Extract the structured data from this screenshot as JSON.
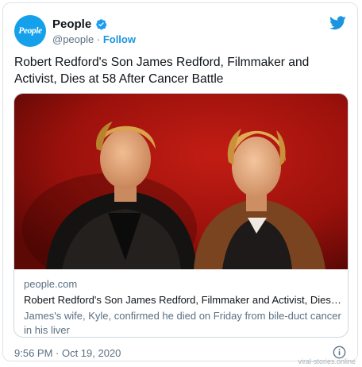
{
  "author": {
    "avatar_text": "People",
    "display_name": "People",
    "handle": "@people",
    "separator": " · ",
    "follow_label": "Follow"
  },
  "tweet": {
    "text": "Robert Redford's Son James Redford, Filmmaker and Activist, Dies at 58 After Cancer Battle"
  },
  "card": {
    "domain": "people.com",
    "title": "Robert Redford's Son James Redford, Filmmaker and Activist, Dies at …",
    "description": "James's wife, Kyle, confirmed he died on Friday from bile-duct cancer in his liver"
  },
  "footer": {
    "timestamp": "9:56 PM · Oct 19, 2020"
  },
  "watermark": "viral-stories.online",
  "colors": {
    "brand_blue": "#1b95e0",
    "verified_blue": "#1d9bf0",
    "photo_background": "#a3140f"
  },
  "icons": [
    "verified-badge-icon",
    "twitter-bird-icon",
    "info-icon"
  ]
}
